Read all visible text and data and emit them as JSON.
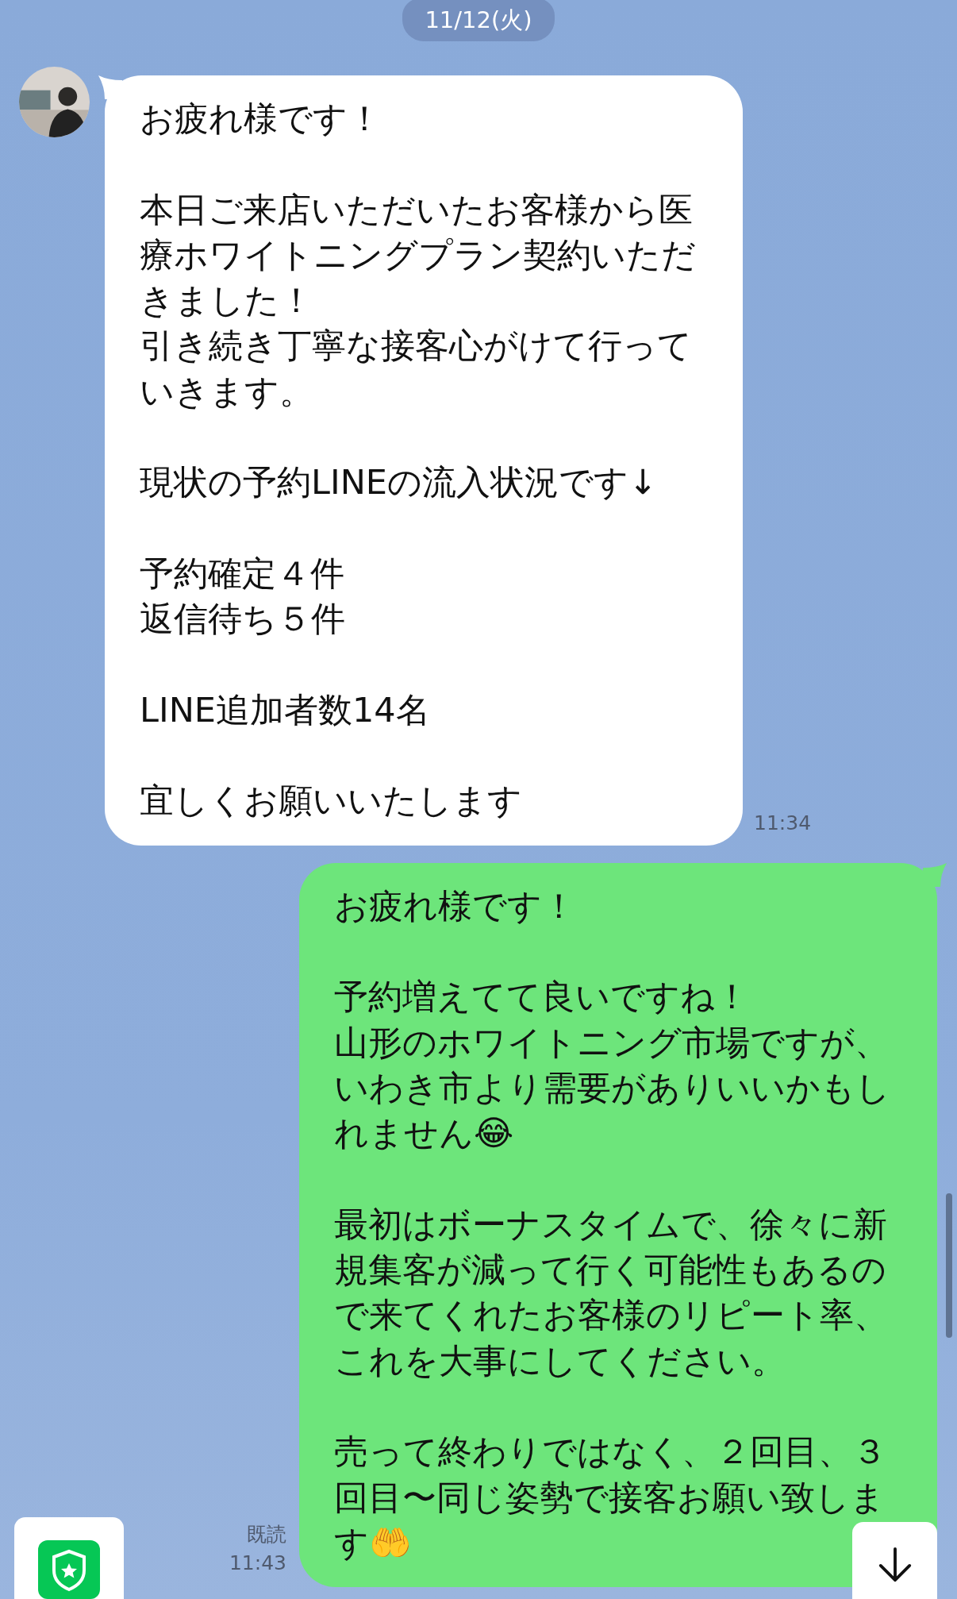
{
  "date_label": "11/12(火)",
  "messages": [
    {
      "kind": "incoming",
      "paragraphs": [
        [
          "お疲れ様です！"
        ],
        [
          "本日ご来店いただいたお客様から医療ホワイトニングプラン契約いただきました！",
          "引き続き丁寧な接客心がけて行っていきます。"
        ],
        [
          "現状の予約LINEの流入状況です↓"
        ],
        [
          "予約確定４件",
          "返信待ち５件"
        ],
        [
          "LINE追加者数14名"
        ],
        [
          "宜しくお願いいたします"
        ]
      ],
      "time": "11:34"
    },
    {
      "kind": "outgoing",
      "paragraphs": [
        [
          "お疲れ様です！"
        ],
        [
          "予約増えてて良いですね！",
          "山形のホワイトニング市場ですが、いわき市より需要がありいいかもしれません😂"
        ],
        [
          "最初はボーナスタイムで、徐々に新規集客が減って行く可能性もあるので来てくれたお客様のリピート率、これを大事にしてください。"
        ],
        [
          "売って終わりではなく、２回目、３回目〜同じ姿勢で接客お願い致します🤲"
        ]
      ],
      "read_label": "既読",
      "time": "11:43"
    }
  ]
}
